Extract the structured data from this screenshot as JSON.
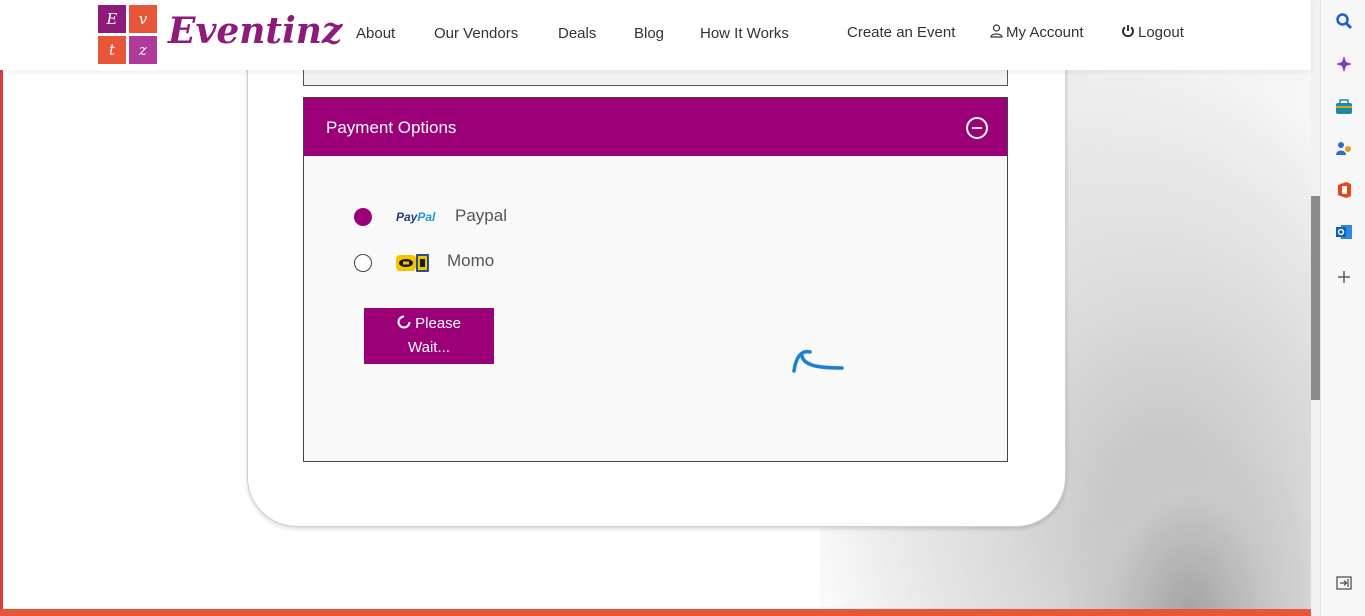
{
  "header": {
    "logo_tiles": [
      "E",
      "v",
      "t",
      "z"
    ],
    "logo_text": "Eventinz",
    "nav": [
      {
        "label": "About"
      },
      {
        "label": "Our Vendors"
      },
      {
        "label": "Deals"
      },
      {
        "label": "Blog"
      },
      {
        "label": "How It Works"
      }
    ],
    "create_event": "Create an Event",
    "my_account": "My Account",
    "logout": "Logout"
  },
  "payment": {
    "title": "Payment Options",
    "options": [
      {
        "label": "Paypal",
        "selected": true,
        "logo_text_a": "Pay",
        "logo_text_b": "Pal"
      },
      {
        "label": "Momo",
        "selected": false
      }
    ],
    "button_line1": "Please",
    "button_line2": "Wait..."
  },
  "colors": {
    "brand_purple": "#9c0078",
    "logo_text": "#8e1a7a",
    "footer_bar": "#e8563a"
  },
  "sidebar_icons": [
    "search-icon",
    "copilot-icon",
    "shopping-icon",
    "people-icon",
    "office-icon",
    "outlook-icon",
    "add-icon",
    "expand-sidebar-icon"
  ]
}
